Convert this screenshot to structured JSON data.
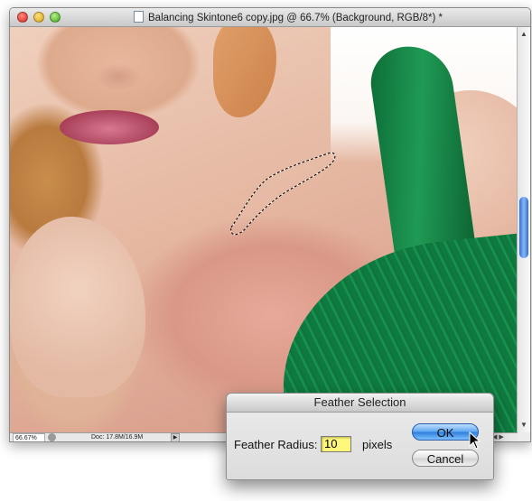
{
  "window": {
    "title": "Balancing Skintone6 copy.jpg @ 66.7% (Background, RGB/8*) *"
  },
  "statusbar": {
    "zoom": "66.67%",
    "doc_size": "Doc: 17.8M/16.9M"
  },
  "dialog": {
    "title": "Feather Selection",
    "radius_label": "Feather Radius:",
    "radius_value": "10",
    "unit": "pixels",
    "ok_label": "OK",
    "cancel_label": "Cancel"
  },
  "colors": {
    "accent": "#2e7fdc",
    "field_highlight": "#fff87a",
    "dress_green": "#0f7a3f"
  },
  "icons": {
    "document": "document-icon",
    "cursor": "arrow-cursor-icon"
  }
}
